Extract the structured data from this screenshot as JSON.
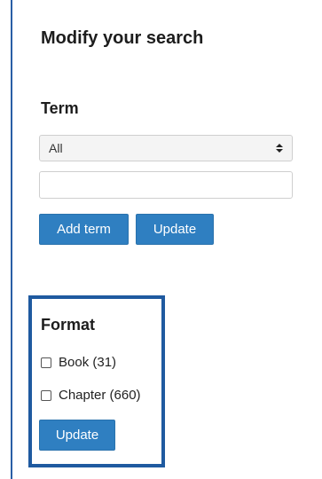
{
  "panel": {
    "title": "Modify your search"
  },
  "term": {
    "heading": "Term",
    "select_value": "All",
    "input_value": "",
    "add_label": "Add term",
    "update_label": "Update"
  },
  "format": {
    "heading": "Format",
    "options": [
      {
        "label": "Book (31)",
        "checked": false
      },
      {
        "label": "Chapter (660)",
        "checked": false
      }
    ],
    "update_label": "Update"
  },
  "colors": {
    "button": "#2f7fc1",
    "highlight_border": "#1f5aa0",
    "left_rule": "#2a5fa6"
  },
  "icons": {
    "select_caret": "sort-caret-icon"
  }
}
